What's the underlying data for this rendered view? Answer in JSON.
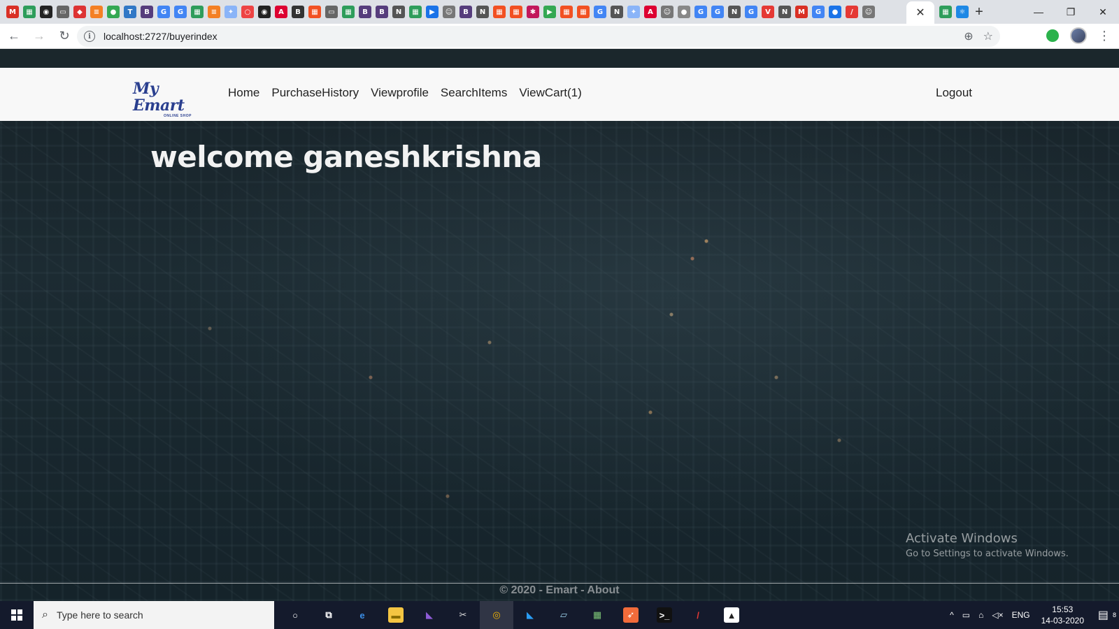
{
  "browser": {
    "favicons": [
      {
        "name": "gmail-favicon-icon",
        "glyph": "M",
        "color": "#d93025"
      },
      {
        "name": "chart-favicon-icon",
        "glyph": "▦",
        "color": "#2e9d5b"
      },
      {
        "name": "github-favicon-icon",
        "glyph": "◉",
        "color": "#222"
      },
      {
        "name": "chat-favicon-icon",
        "glyph": "▭",
        "color": "#666"
      },
      {
        "name": "app-favicon-icon",
        "glyph": "◆",
        "color": "#d33"
      },
      {
        "name": "stack-favicon-icon",
        "glyph": "≡",
        "color": "#f48024"
      },
      {
        "name": "globe-favicon-icon",
        "glyph": "●",
        "color": "#34a853"
      },
      {
        "name": "typescript-favicon-icon",
        "glyph": "T",
        "color": "#3178c6"
      },
      {
        "name": "bootstrap-favicon-icon",
        "glyph": "B",
        "color": "#563d7c"
      },
      {
        "name": "google-favicon-icon",
        "glyph": "G",
        "color": "#4285f4"
      },
      {
        "name": "google-favicon-icon",
        "glyph": "G",
        "color": "#4285f4"
      },
      {
        "name": "chart-favicon-icon",
        "glyph": "▦",
        "color": "#2e9d5b"
      },
      {
        "name": "stack-favicon-icon",
        "glyph": "≡",
        "color": "#f48024"
      },
      {
        "name": "pin-favicon-icon",
        "glyph": "✦",
        "color": "#8ab4f8"
      },
      {
        "name": "circle-favicon-icon",
        "glyph": "○",
        "color": "#e44"
      },
      {
        "name": "github-favicon-icon",
        "glyph": "◉",
        "color": "#222"
      },
      {
        "name": "angular-favicon-icon",
        "glyph": "A",
        "color": "#dd0031"
      },
      {
        "name": "bold-favicon-icon",
        "glyph": "B",
        "color": "#333"
      },
      {
        "name": "microsoft-favicon-icon",
        "glyph": "▦",
        "color": "#f25022"
      },
      {
        "name": "chat-favicon-icon",
        "glyph": "▭",
        "color": "#666"
      },
      {
        "name": "chart-favicon-icon",
        "glyph": "▦",
        "color": "#2e9d5b"
      },
      {
        "name": "bootstrap-favicon-icon",
        "glyph": "B",
        "color": "#563d7c"
      },
      {
        "name": "bootstrap-favicon-icon",
        "glyph": "B",
        "color": "#563d7c"
      },
      {
        "name": "notion-favicon-icon",
        "glyph": "N",
        "color": "#555"
      },
      {
        "name": "chart-favicon-icon",
        "glyph": "▦",
        "color": "#2e9d5b"
      },
      {
        "name": "video-favicon-icon",
        "glyph": "▶",
        "color": "#1a73e8"
      },
      {
        "name": "user-favicon-icon",
        "glyph": "☺",
        "color": "#777"
      },
      {
        "name": "bootstrap-favicon-icon",
        "glyph": "B",
        "color": "#563d7c"
      },
      {
        "name": "notion-favicon-icon",
        "glyph": "N",
        "color": "#555"
      },
      {
        "name": "microsoft-favicon-icon",
        "glyph": "▦",
        "color": "#f25022"
      },
      {
        "name": "microsoft-favicon-icon",
        "glyph": "▦",
        "color": "#f25022"
      },
      {
        "name": "bug-favicon-icon",
        "glyph": "✱",
        "color": "#c2185b"
      },
      {
        "name": "play-favicon-icon",
        "glyph": "▶",
        "color": "#34a853"
      },
      {
        "name": "microsoft-favicon-icon",
        "glyph": "▦",
        "color": "#f25022"
      },
      {
        "name": "microsoft-favicon-icon",
        "glyph": "▦",
        "color": "#f25022"
      },
      {
        "name": "google-favicon-icon",
        "glyph": "G",
        "color": "#4285f4"
      },
      {
        "name": "notion-favicon-icon",
        "glyph": "N",
        "color": "#555"
      },
      {
        "name": "pin-favicon-icon",
        "glyph": "✦",
        "color": "#8ab4f8"
      },
      {
        "name": "angular-favicon-icon",
        "glyph": "A",
        "color": "#dd0031"
      },
      {
        "name": "user-favicon-icon",
        "glyph": "☺",
        "color": "#777"
      },
      {
        "name": "globe-favicon-icon",
        "glyph": "●",
        "color": "#888"
      },
      {
        "name": "google-favicon-icon",
        "glyph": "G",
        "color": "#4285f4"
      },
      {
        "name": "google-favicon-icon",
        "glyph": "G",
        "color": "#4285f4"
      },
      {
        "name": "notion-favicon-icon",
        "glyph": "N",
        "color": "#555"
      },
      {
        "name": "google-favicon-icon",
        "glyph": "G",
        "color": "#4285f4"
      },
      {
        "name": "vue-favicon-icon",
        "glyph": "V",
        "color": "#e53935"
      },
      {
        "name": "notion-favicon-icon",
        "glyph": "N",
        "color": "#555"
      },
      {
        "name": "gmail-favicon-icon",
        "glyph": "M",
        "color": "#d93025"
      },
      {
        "name": "google-favicon-icon",
        "glyph": "G",
        "color": "#4285f4"
      },
      {
        "name": "globe-favicon-icon",
        "glyph": "●",
        "color": "#1a73e8"
      },
      {
        "name": "pen-favicon-icon",
        "glyph": "/",
        "color": "#e53935"
      },
      {
        "name": "user-favicon-icon",
        "glyph": "☺",
        "color": "#777"
      }
    ],
    "active_tab_close": "✕",
    "extra_favicons": [
      {
        "name": "chart-favicon-icon",
        "glyph": "▦",
        "color": "#2e9d5b"
      },
      {
        "name": "react-favicon-icon",
        "glyph": "⚛",
        "color": "#1e88e5"
      }
    ],
    "new_tab": "+",
    "window_controls": [
      "—",
      "❐",
      "✕"
    ],
    "nav": {
      "back": "←",
      "forward": "→",
      "reload": "↻"
    },
    "info_icon": "i",
    "url": "localhost:2727/buyerindex",
    "zoom_icon": "⊕",
    "star_icon": "☆",
    "menu_icon": "⋮"
  },
  "site": {
    "logo_text": "My Emart",
    "logo_sub": "ONLINE SHOP",
    "nav_links": [
      "Home",
      "PurchaseHistory",
      "Viewprofile",
      "SearchItems",
      "ViewCart(1)"
    ],
    "logout": "Logout",
    "welcome": "welcome ganeshkrishna",
    "footer": "© 2020 - Emart - About"
  },
  "os_overlay": {
    "line1": "Activate Windows",
    "line2": "Go to Settings to activate Windows."
  },
  "taskbar": {
    "search_placeholder": "Type here to search",
    "apps": [
      {
        "name": "cortana-icon",
        "glyph": "○",
        "bg": "transparent",
        "color": "#fff"
      },
      {
        "name": "task-view-icon",
        "glyph": "⧉",
        "bg": "transparent",
        "color": "#fff"
      },
      {
        "name": "edge-icon",
        "glyph": "e",
        "bg": "transparent",
        "color": "#3b8ee6"
      },
      {
        "name": "file-explorer-icon",
        "glyph": "▬",
        "bg": "#f4c542",
        "color": "#8a6d00"
      },
      {
        "name": "visual-studio-icon",
        "glyph": "◣",
        "bg": "transparent",
        "color": "#8e5bd6"
      },
      {
        "name": "tools-icon",
        "glyph": "✂",
        "bg": "transparent",
        "color": "#ddd"
      },
      {
        "name": "chrome-icon",
        "glyph": "◎",
        "bg": "transparent",
        "color": "#f4b400",
        "active": true
      },
      {
        "name": "vscode-icon",
        "glyph": "◣",
        "bg": "transparent",
        "color": "#2a9df4"
      },
      {
        "name": "notes-icon",
        "glyph": "▱",
        "bg": "transparent",
        "color": "#9fd5ee"
      },
      {
        "name": "office-icon",
        "glyph": "▦",
        "bg": "transparent",
        "color": "#7cc576"
      },
      {
        "name": "postman-icon",
        "glyph": "➶",
        "bg": "#f26b3a",
        "color": "#fff"
      },
      {
        "name": "terminal-icon",
        "glyph": ">_",
        "bg": "#111",
        "color": "#fff"
      },
      {
        "name": "pen-app-icon",
        "glyph": "/",
        "bg": "transparent",
        "color": "#e53935"
      },
      {
        "name": "photos-icon",
        "glyph": "▲",
        "bg": "#fff",
        "color": "#222"
      }
    ],
    "tray": {
      "chevron": "^",
      "lang": "ENG",
      "time": "15:53",
      "date": "14-03-2020",
      "notifications": "8"
    }
  }
}
